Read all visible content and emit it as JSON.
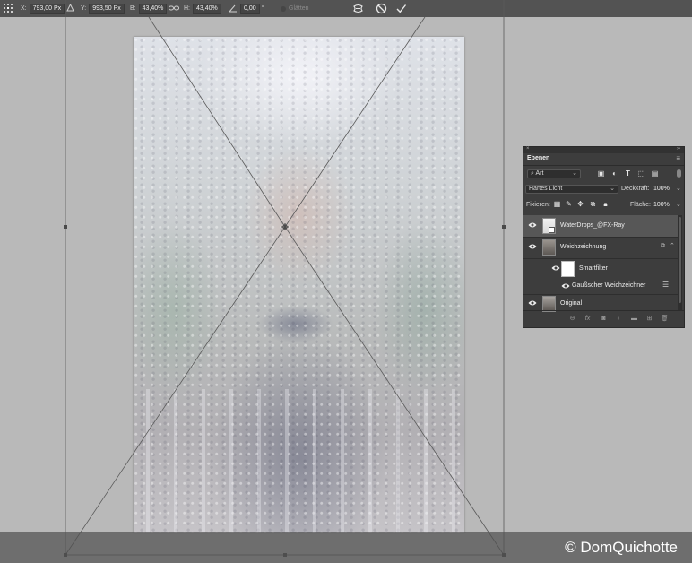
{
  "options_bar": {
    "x_label": "X:",
    "x_value": "793,00 Px",
    "y_label": "Y:",
    "y_value": "993,50 Px",
    "b_label": "B:",
    "b_value": "43,40%",
    "h_label": "H:",
    "h_value": "43,40%",
    "angle_value": "0,00",
    "angle_unit": "°",
    "smooth_label": "Glätten"
  },
  "watermark": {
    "text": "© DomQuichotte"
  },
  "layers_panel": {
    "tab": "Ebenen",
    "filter_kind": "Art",
    "blend_mode": "Hartes Licht",
    "opacity_label": "Deckkraft:",
    "opacity_value": "100%",
    "lock_label": "Fixieren:",
    "fill_label": "Fläche:",
    "fill_value": "100%",
    "layers": [
      {
        "name": "WaterDrops_@FX-Ray",
        "active": true
      },
      {
        "name": "Weichzeichnung",
        "active": false
      },
      {
        "name": "Smartfilter",
        "active": false
      },
      {
        "name": "Gaußscher Weichzeichner",
        "active": false
      },
      {
        "name": "Original",
        "active": false
      }
    ]
  },
  "colors": {
    "canvas_bg": "#b9b9b9",
    "panel_bg": "#3d3d3d",
    "active_layer": "#575757",
    "options_bar": "#535353"
  }
}
